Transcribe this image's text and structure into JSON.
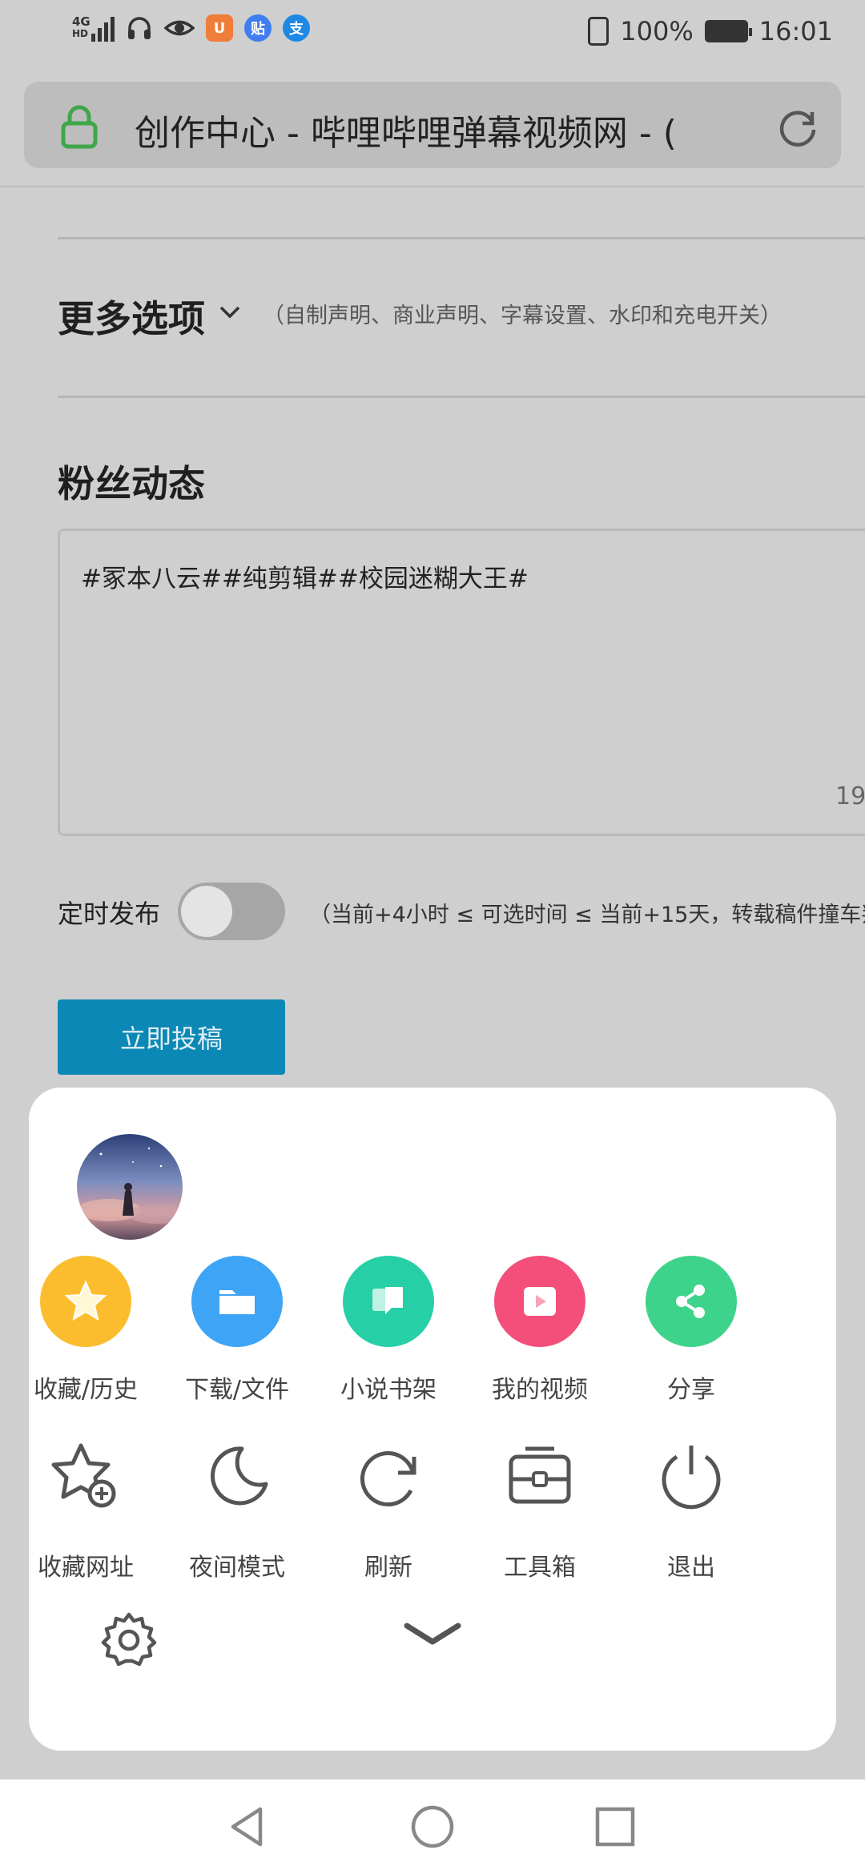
{
  "status_bar": {
    "network": "4G",
    "network_sub": "HD",
    "battery": "100%",
    "time": "16:01",
    "app_icons": [
      {
        "name": "headphones-icon"
      },
      {
        "name": "eye-icon"
      },
      {
        "name": "uc-browser-icon",
        "color": "#f07d3a"
      },
      {
        "name": "tieba-icon",
        "glyph": "贴",
        "color": "#3f7df0"
      },
      {
        "name": "alipay-icon",
        "glyph": "支",
        "color": "#1e88e5"
      }
    ]
  },
  "url_bar": {
    "title": "创作中心 - 哔哩哔哩弹幕视频网 - ("
  },
  "page": {
    "more_options": {
      "title": "更多选项",
      "hint": "（自制声明、商业声明、字幕设置、水印和充电开关）"
    },
    "fans": {
      "title": "粉丝动态",
      "text": "#冢本八云##纯剪辑##校园迷糊大王#",
      "count": "19"
    },
    "schedule": {
      "label": "定时发布",
      "enabled": false,
      "hint": "（当前+4小时 ≤ 可选时间 ≤ 当前+15天，转载稿件撞车判"
    },
    "submit_label": "立即投稿"
  },
  "menu": {
    "row1": [
      {
        "label": "收藏/历史",
        "icon": "star-icon",
        "color": "#fbbd2e"
      },
      {
        "label": "下载/文件",
        "icon": "folder-icon",
        "color": "#3ea4f5"
      },
      {
        "label": "小说书架",
        "icon": "book-icon",
        "color": "#26cfa6"
      },
      {
        "label": "我的视频",
        "icon": "play-icon",
        "color": "#f44f7a"
      },
      {
        "label": "分享",
        "icon": "share-icon",
        "color": "#3ed38a"
      }
    ],
    "row2": [
      {
        "label": "收藏网址",
        "icon": "add-bookmark-icon"
      },
      {
        "label": "夜间模式",
        "icon": "moon-icon"
      },
      {
        "label": "刷新",
        "icon": "refresh-icon"
      },
      {
        "label": "工具箱",
        "icon": "toolbox-icon"
      },
      {
        "label": "退出",
        "icon": "power-icon"
      }
    ]
  },
  "colors": {
    "accent": "#0b88b5",
    "secure": "#3fa64a"
  }
}
